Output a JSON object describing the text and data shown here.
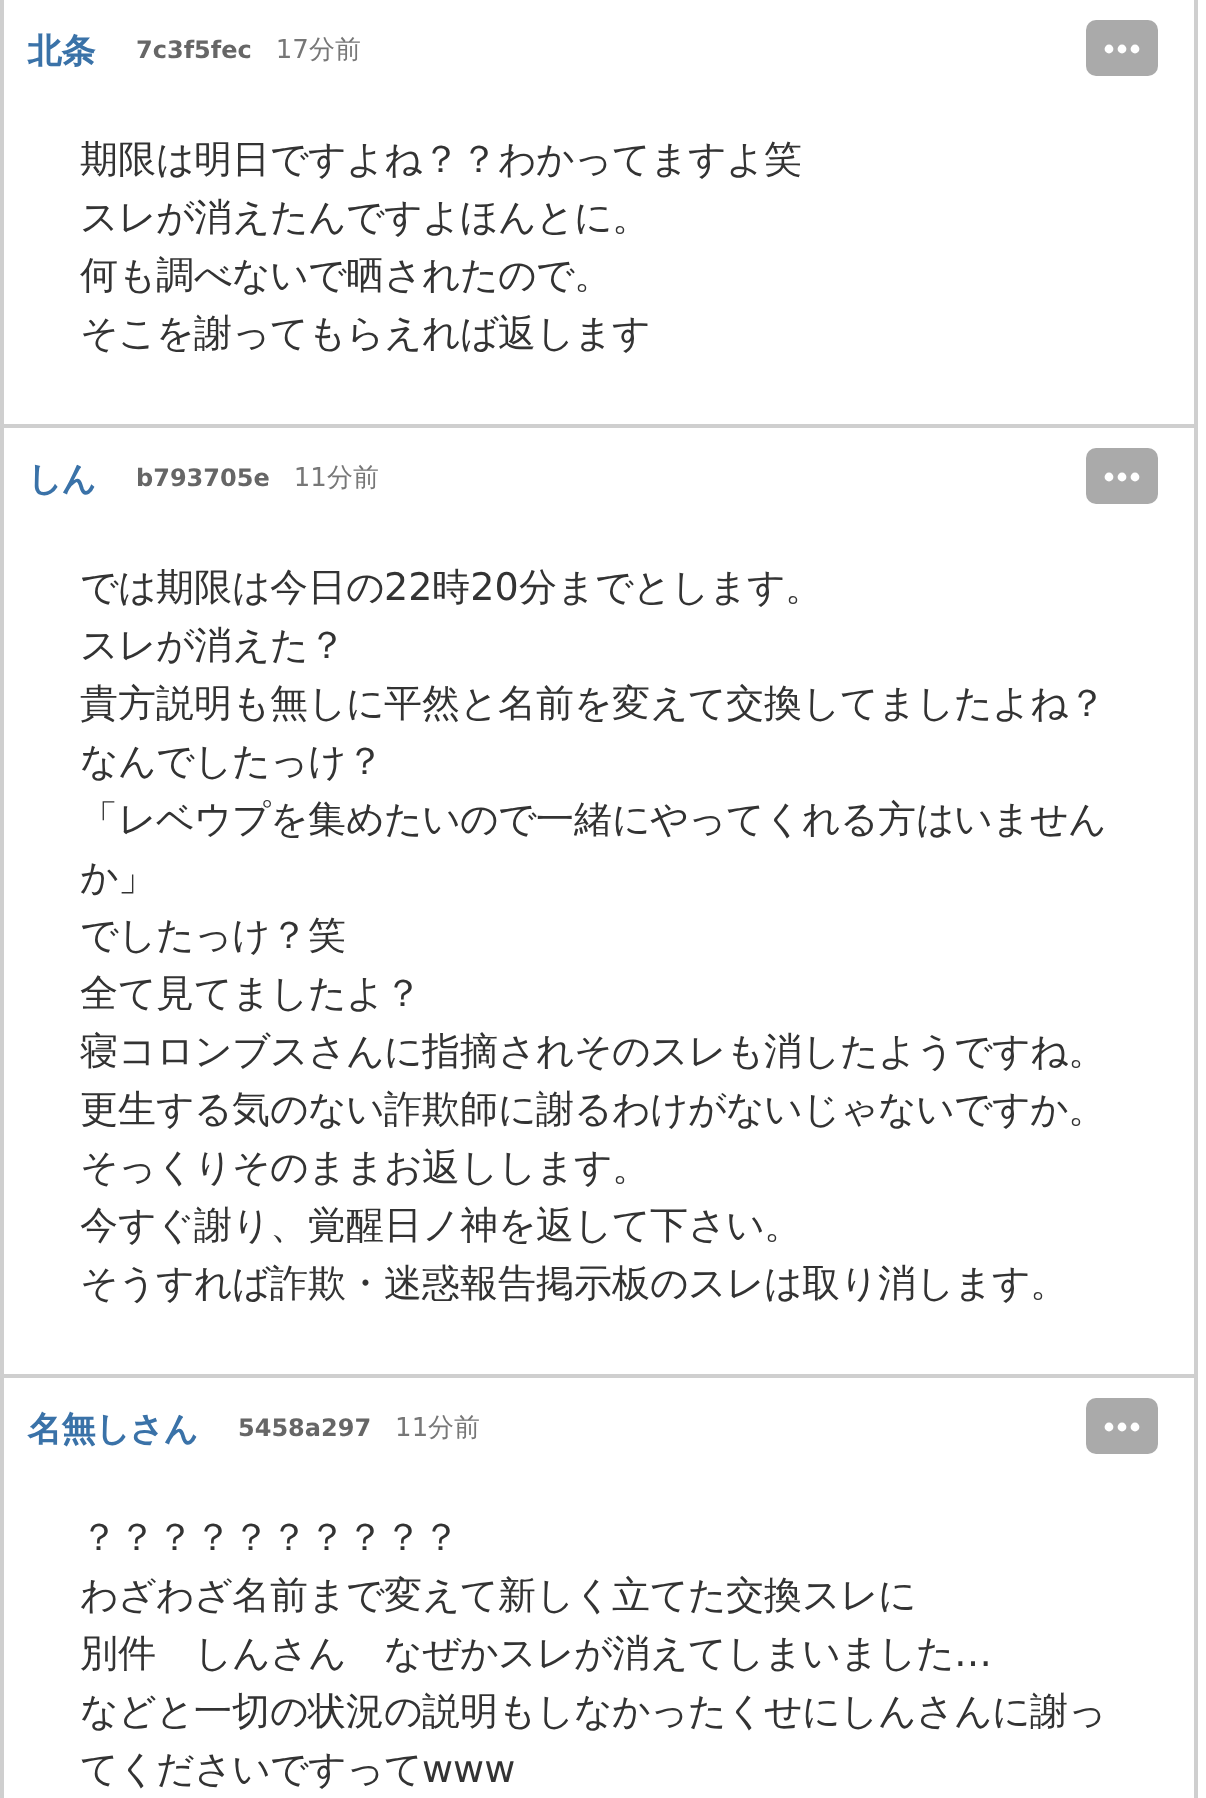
{
  "comments": [
    {
      "author": "北条",
      "user_id": "7c3f5fec",
      "time": "17分前",
      "lines": [
        "期限は明日ですよね？？わかってますよ笑",
        "スレが消えたんですよほんとに。",
        "何も調べないで晒されたので。",
        "そこを謝ってもらえれば返します"
      ]
    },
    {
      "author": "しん",
      "user_id": "b793705e",
      "time": "11分前",
      "lines": [
        "では期限は今日の22時20分までとします。",
        "スレが消えた？",
        "貴方説明も無しに平然と名前を変えて交換してましたよね？",
        "なんでしたっけ？",
        "「レベウプを集めたいので一緒にやってくれる方はいませんか」",
        "でしたっけ？笑",
        "全て見てましたよ？",
        "寝コロンブスさんに指摘されそのスレも消したようですね。",
        "更生する気のない詐欺師に謝るわけがないじゃないですか。",
        "そっくりそのままお返しします。",
        "今すぐ謝り、覚醒日ノ神を返して下さい。",
        "そうすれば詐欺・迷惑報告掲示板のスレは取り消します。"
      ]
    },
    {
      "author": "名無しさん",
      "user_id": "5458a297",
      "time": "11分前",
      "lines": [
        "？？？？？？？？？？",
        "わざわざ名前まで変えて新しく立てた交換スレに",
        "別件　しんさん　なぜかスレが消えてしまいました…",
        "などと一切の状況の説明もしなかったくせにしんさんに謝ってくださいですってwww"
      ]
    }
  ]
}
